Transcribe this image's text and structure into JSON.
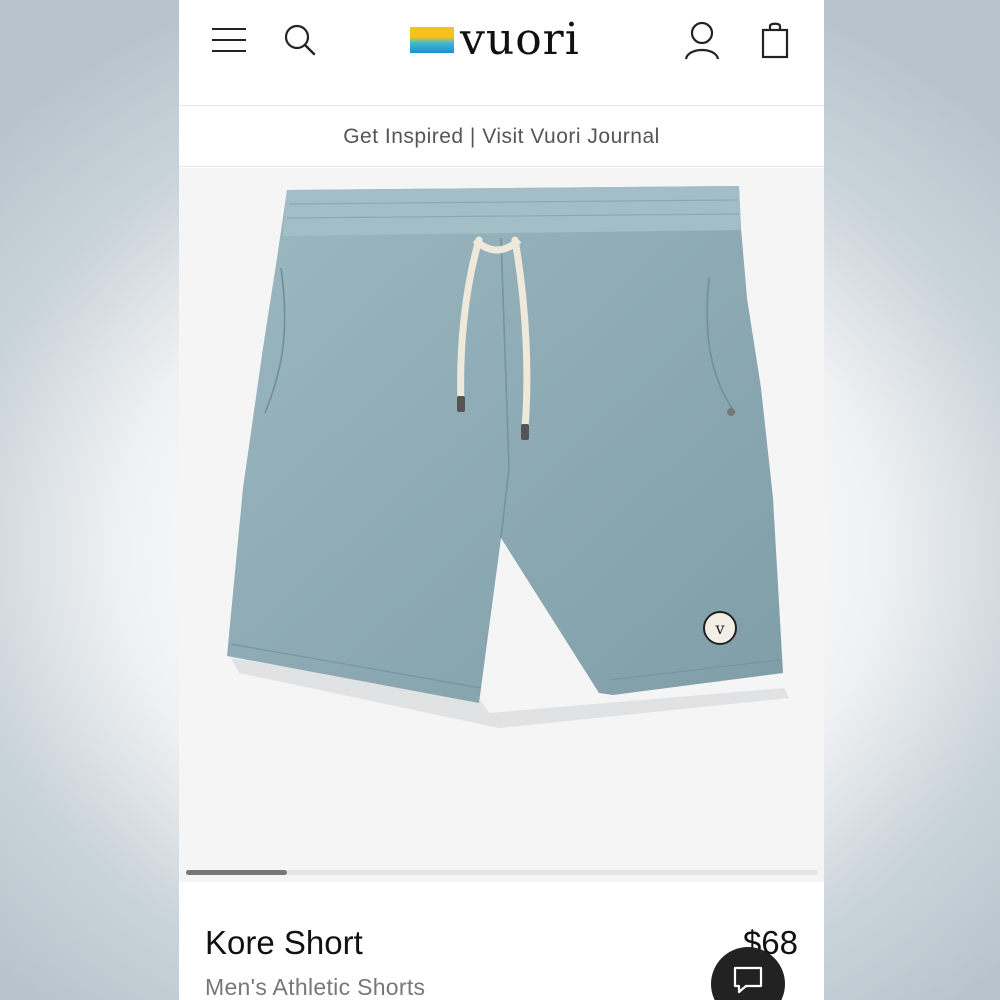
{
  "header": {
    "menu_icon": "hamburger-menu-icon",
    "search_icon": "search-icon",
    "logo_text": "vuori",
    "account_icon": "user-icon",
    "cart_icon": "shopping-bag-icon"
  },
  "promo_banner": {
    "text": "Get Inspired | Visit Vuori Journal"
  },
  "gallery": {
    "image_alt": "Kore Short",
    "progress": 0.16,
    "product_color": "#8fadb6"
  },
  "product": {
    "name": "Kore Short",
    "price": "$68",
    "category": "Men's Athletic Shorts"
  },
  "chat": {
    "icon": "chat-bubble-icon"
  },
  "colors": {
    "brand_yellow": "#f6c21a",
    "brand_blue": "#1c8fd0",
    "text_primary": "#111111",
    "text_secondary": "#777777"
  }
}
